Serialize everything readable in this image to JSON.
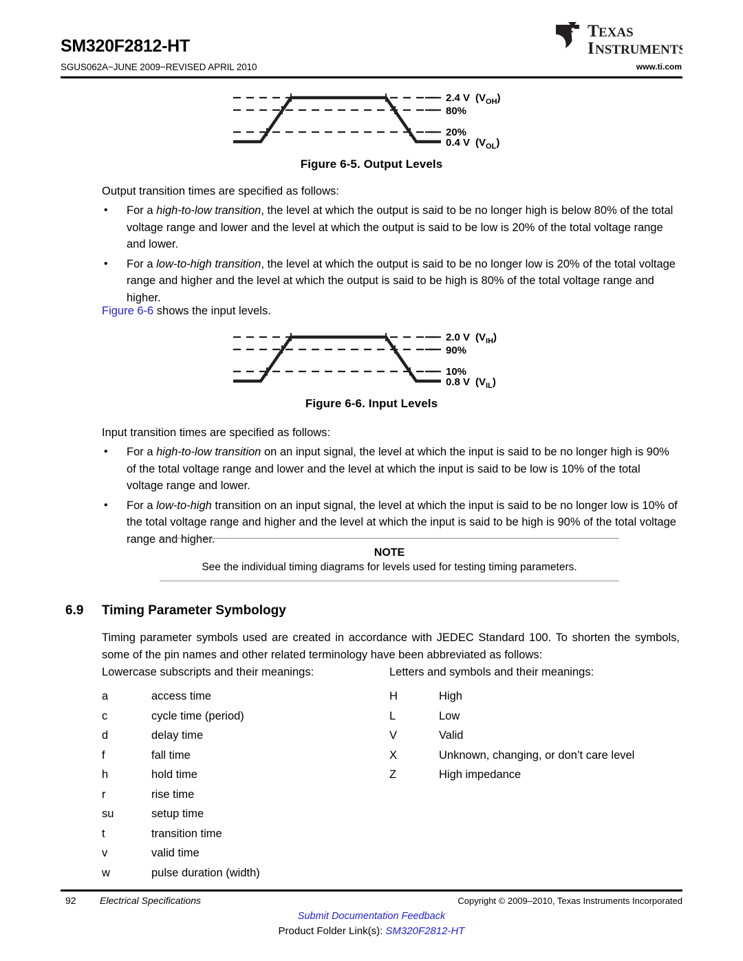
{
  "header": {
    "doc_title": "SM320F2812-HT",
    "doc_id": "SGUS062A−JUNE 2009−REVISED APRIL 2010",
    "url": "www.ti.com",
    "logo_line1": "TEXAS",
    "logo_line2": "INSTRUMENTS",
    "logo_name": "texas-instruments-logo"
  },
  "figure_output": {
    "caption": "Figure 6-5. Output Levels",
    "labels": {
      "high_value": "2.4 V",
      "high_symbol": "(V",
      "high_sub": "OH",
      "high_close": ")",
      "upper_pct": "80%",
      "lower_pct": "20%",
      "low_value": "0.4 V",
      "low_symbol": "(V",
      "low_sub": "OL",
      "low_close": ")"
    }
  },
  "figure_input": {
    "caption": "Figure 6-6. Input Levels",
    "labels": {
      "high_value": "2.0 V",
      "high_symbol": "(V",
      "high_sub": "IH",
      "high_close": ")",
      "upper_pct": "90%",
      "lower_pct": "10%",
      "low_value": "0.8 V",
      "low_symbol": "(V",
      "low_sub": "IL",
      "low_close": ")"
    }
  },
  "output_section": {
    "lead": "Output transition times are specified as follows:",
    "bullet1_pre": "For a ",
    "bullet1_italic": "high-to-low transition",
    "bullet1_post": ", the level at which the output is said to be no longer high is below 80% of the total voltage range and lower and the level at which the output is said to be low is 20% of the total voltage range and lower.",
    "bullet2_pre": "For a ",
    "bullet2_italic": "low-to-high transition",
    "bullet2_post": ", the level at which the output is said to be no longer low is 20% of the total voltage range and higher and the level at which the output is said to be high is 80% of the total voltage range and higher.",
    "figure_ref_link": "Figure 6-6",
    "figure_ref_rest": " shows the input levels."
  },
  "input_section": {
    "lead": "Input transition times are specified as follows:",
    "bullet1_pre": "For a ",
    "bullet1_italic": "high-to-low transition",
    "bullet1_post": " on an input signal, the level at which the input is said to be no longer high is 90% of the total voltage range and lower and the level at which the input is said to be low is 10% of the total voltage range and lower.",
    "bullet2_pre": "For a ",
    "bullet2_italic": "low-to-high",
    "bullet2_post": " transition on an input signal, the level at which the input is said to be no longer low is 10% of the total voltage range and higher and the level at which the input is said to be high is 90% of the total voltage range and higher."
  },
  "note": {
    "title": "NOTE",
    "body": "See the individual timing diagrams for levels used for testing timing parameters."
  },
  "section": {
    "number": "6.9",
    "title": "Timing Parameter Symbology",
    "paragraph": "Timing parameter symbols used are created in accordance with JEDEC Standard 100. To shorten the symbols, some of the pin names and other related terminology have been abbreviated as follows:"
  },
  "symbology": {
    "left_heading": "Lowercase subscripts and their meanings:",
    "right_heading": "Letters and symbols and their meanings:",
    "left_rows": [
      {
        "key": "a",
        "value": "access time"
      },
      {
        "key": "c",
        "value": "cycle time (period)"
      },
      {
        "key": "d",
        "value": "delay time"
      },
      {
        "key": "f",
        "value": "fall time"
      },
      {
        "key": "h",
        "value": "hold time"
      },
      {
        "key": "r",
        "value": "rise time"
      },
      {
        "key": "su",
        "value": "setup time"
      },
      {
        "key": "t",
        "value": "transition time"
      },
      {
        "key": "v",
        "value": "valid time"
      },
      {
        "key": "w",
        "value": "pulse duration (width)"
      }
    ],
    "right_rows": [
      {
        "key": "H",
        "value": "High"
      },
      {
        "key": "L",
        "value": "Low"
      },
      {
        "key": "V",
        "value": "Valid"
      },
      {
        "key": "X",
        "value": "Unknown, changing, or don’t care level"
      },
      {
        "key": "Z",
        "value": "High impedance"
      }
    ]
  },
  "footer": {
    "page_number": "92",
    "section_name": "Electrical Specifications",
    "copyright": "Copyright © 2009–2010, Texas Instruments Incorporated",
    "feedback_link": "Submit Documentation Feedback",
    "folder_label": "Product Folder Link(s):",
    "folder_link": "SM320F2812-HT"
  },
  "colors": {
    "link": "#2222dd",
    "text": "#000000",
    "rule": "#000000",
    "note_rule": "#8d8d8d"
  }
}
